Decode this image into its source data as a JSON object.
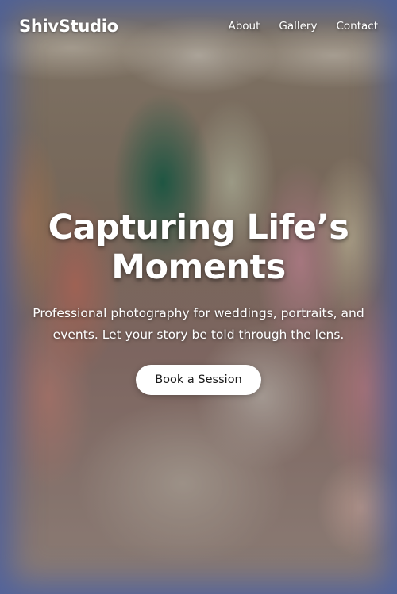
{
  "brand": {
    "name": "ShivStudio"
  },
  "nav": {
    "links": [
      {
        "label": "About"
      },
      {
        "label": "Gallery"
      },
      {
        "label": "Contact"
      }
    ]
  },
  "hero": {
    "headline": "Capturing Life’s Moments",
    "subtext": "Professional photography for weddings, portraits, and events. Let your story be told through the lens.",
    "cta_label": "Book a Session",
    "background_description": "group photo of wedding party in traditional Indian attire"
  },
  "colors": {
    "text": "#ffffff",
    "button_bg": "#ffffff",
    "button_text": "#1a1a1a",
    "edge_tint": "#3c5aaa"
  }
}
